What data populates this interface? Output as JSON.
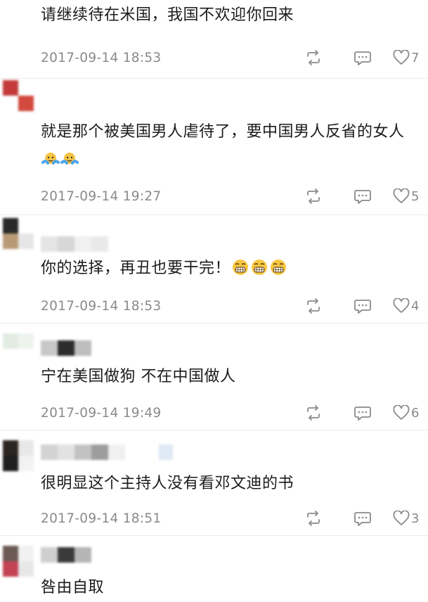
{
  "comments": [
    {
      "text": "请继续待在米国，我国不欢迎你回来",
      "time": "2017-09-14 18:53",
      "likes": "7",
      "emojis": []
    },
    {
      "text": "就是那个被美国男人虐待了，要中国男人反省的女人",
      "time": "2017-09-14 19:27",
      "likes": "5",
      "emojis": [
        "sweat-smile-emoji",
        "sweat-smile-emoji"
      ]
    },
    {
      "text": "你的选择，再丑也要干完！",
      "time": "2017-09-14 18:53",
      "likes": "4",
      "emojis": [
        "grin-emoji",
        "grin-emoji",
        "grin-emoji"
      ]
    },
    {
      "text": "宁在美国做狗 不在中国做人",
      "time": "2017-09-14 19:49",
      "likes": "6",
      "emojis": []
    },
    {
      "text": "很明显这个主持人没有看邓文迪的书",
      "time": "2017-09-14 18:51",
      "likes": "3",
      "emojis": []
    },
    {
      "text": "咎由自取",
      "time": "",
      "likes": "",
      "emojis": []
    }
  ],
  "colors": {
    "meta": "#8a8a8a",
    "text": "#1b1b1b",
    "divider": "#ececec"
  }
}
